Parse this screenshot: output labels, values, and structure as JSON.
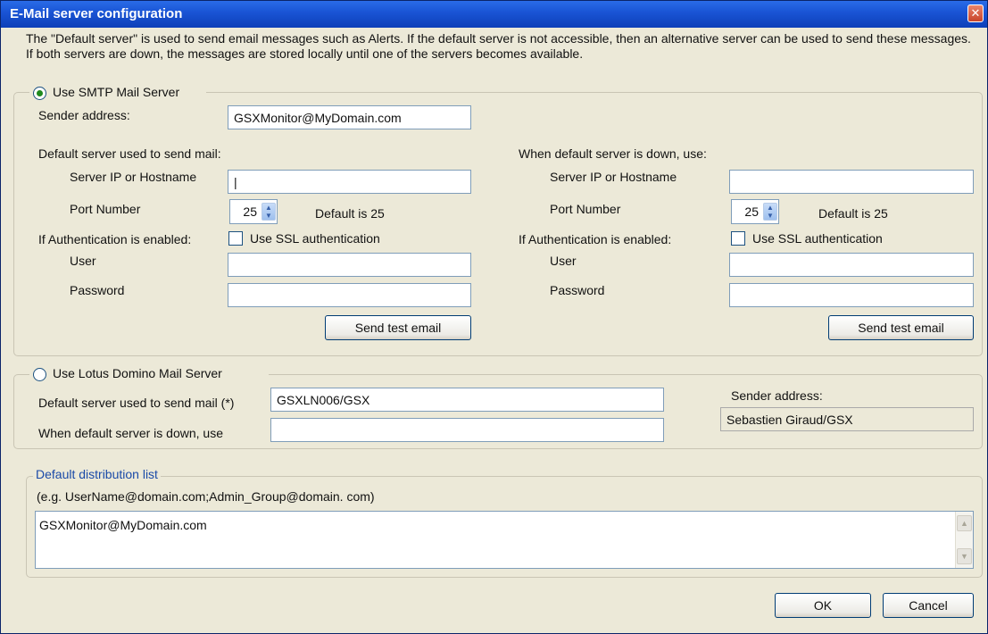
{
  "window": {
    "title": "E-Mail server configuration",
    "close_glyph": "✕"
  },
  "description": "The \"Default server\" is used to send email messages such as Alerts. If the default server is not accessible, then an alternative server can be used to send these messages.  If both servers are down, the messages are stored locally until one of the servers becomes available.",
  "smtp": {
    "radio_label": "Use SMTP Mail Server",
    "selected": true,
    "sender_label": "Sender address:",
    "sender_value": "GSXMonitor@MyDomain.com",
    "default_heading": "Default server used to send mail:",
    "alt_heading": "When default server is down, use:",
    "server_label": "Server IP or Hostname",
    "port_label": "Port Number",
    "port_value": "25",
    "port_hint": "Default is 25",
    "auth_label": "If Authentication is enabled:",
    "ssl_label": "Use SSL authentication",
    "user_label": "User",
    "password_label": "Password",
    "test_button": "Send test email",
    "default_server_value": "|",
    "alt_server_value": ""
  },
  "lotus": {
    "radio_label": "Use Lotus Domino Mail Server",
    "selected": false,
    "default_label": "Default server used to send mail (*)",
    "default_value": "GSXLN006/GSX",
    "alt_label": "When default server is down, use",
    "alt_value": "",
    "sender_label": "Sender address:",
    "sender_value": "Sebastien Giraud/GSX"
  },
  "distribution": {
    "legend": "Default distribution list",
    "example": "(e.g. UserName@domain.com;Admin_Group@domain. com)",
    "value": "GSXMonitor@MyDomain.com"
  },
  "buttons": {
    "ok": "OK",
    "cancel": "Cancel"
  },
  "colors": {
    "titlebar": "#0d3fb8",
    "dialog_bg": "#ece9d8",
    "legend_text": "#1a4aa8"
  }
}
